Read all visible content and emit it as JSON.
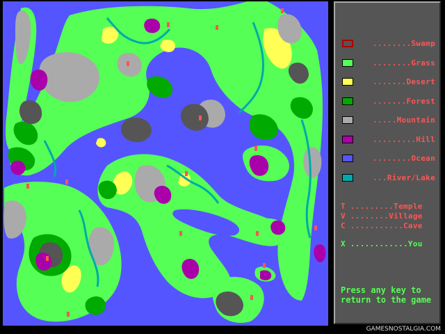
{
  "legend": {
    "items": [
      {
        "label": "........Swamp",
        "color": "#555555",
        "outline": "#aa0000"
      },
      {
        "label": "........Grass",
        "color": "#55ff55",
        "outline": "#000000"
      },
      {
        "label": ".......Desert",
        "color": "#ffff55",
        "outline": "#000000"
      },
      {
        "label": ".......Forest",
        "color": "#00aa00",
        "outline": "#000000"
      },
      {
        "label": ".....Mountain",
        "color": "#aaaaaa",
        "outline": "#000000"
      },
      {
        "label": ".........Hill",
        "color": "#aa00aa",
        "outline": "#000000"
      },
      {
        "label": "........Ocean",
        "color": "#5555ff",
        "outline": "#000000"
      },
      {
        "label": "...River/Lake",
        "color": "#00aaaa",
        "outline": "#000000"
      }
    ],
    "symbols": [
      {
        "text": "T .........Temple",
        "kind": "site"
      },
      {
        "text": "V ........Village",
        "kind": "site"
      },
      {
        "text": "C ...........Cave",
        "kind": "site"
      },
      {
        "text": "X ............You",
        "kind": "you"
      }
    ],
    "message": "Press any key to return to the game"
  },
  "colors": {
    "ocean": "#5555ff",
    "grass": "#55ff55",
    "desert": "#ffff55",
    "forest": "#00aa00",
    "mountain": "#aaaaaa",
    "hill": "#aa00aa",
    "swamp": "#555555",
    "river": "#00aaaa",
    "site_text": "#ff5555",
    "you_text": "#55ff55",
    "panel": "#555555"
  },
  "watermark": "GAMESNOSTALGIA.COM"
}
